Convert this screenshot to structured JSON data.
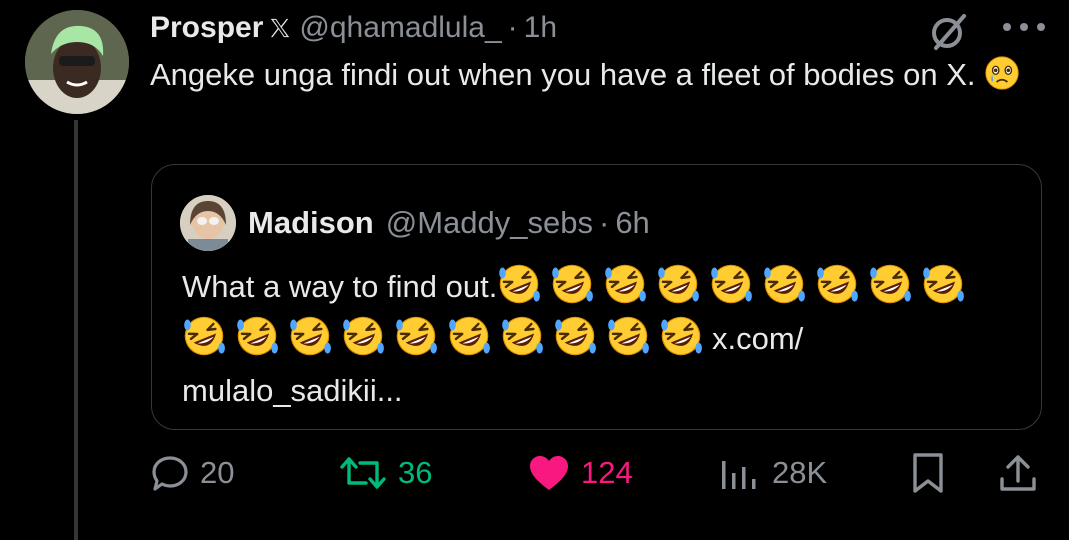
{
  "tweet": {
    "author_name": "Prosper",
    "author_handle": "@qhamadlula_",
    "separator": "·",
    "time": "1h",
    "text": "Angeke unga findi out when you have a fleet of bodies on X.",
    "text_emoji": "face-holding-back-tears"
  },
  "quote": {
    "author_name": "Madison",
    "author_handle": "@Maddy_sebs",
    "separator": "·",
    "time": "6h",
    "text": "What a way to find out.",
    "emoji_name": "rolling-on-floor-laughing",
    "emoji_count": 19,
    "link_text": "x.com/",
    "link_text_2": "mulalo_sadikii..."
  },
  "actions": {
    "replies": "20",
    "reposts": "36",
    "likes": "124",
    "views": "28K"
  },
  "colors": {
    "background": "#000000",
    "text": "#e7e9ea",
    "muted": "#8b9097",
    "border": "#34383b",
    "repost_green": "#00ba7c",
    "like_pink": "#f91880",
    "emoji_yellow": "#ffcc32"
  }
}
